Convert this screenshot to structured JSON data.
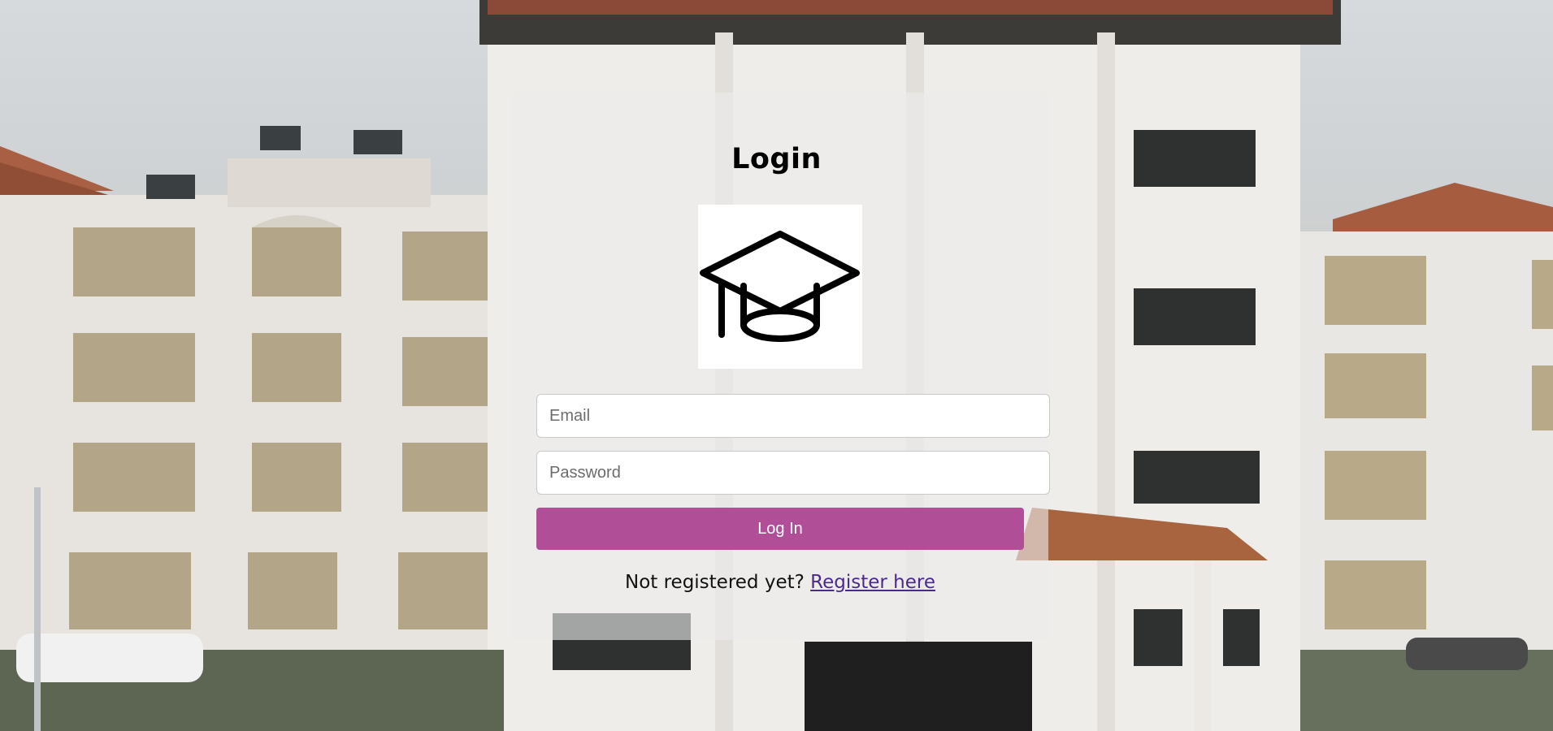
{
  "login": {
    "title": "Login",
    "logo_icon": "graduation-cap-icon",
    "email_placeholder": "Email",
    "password_placeholder": "Password",
    "submit_label": "Log In",
    "register_prompt": "Not registered yet? ",
    "register_link": "Register here"
  },
  "colors": {
    "button": "#b04e98",
    "link": "#4b2a8a"
  }
}
